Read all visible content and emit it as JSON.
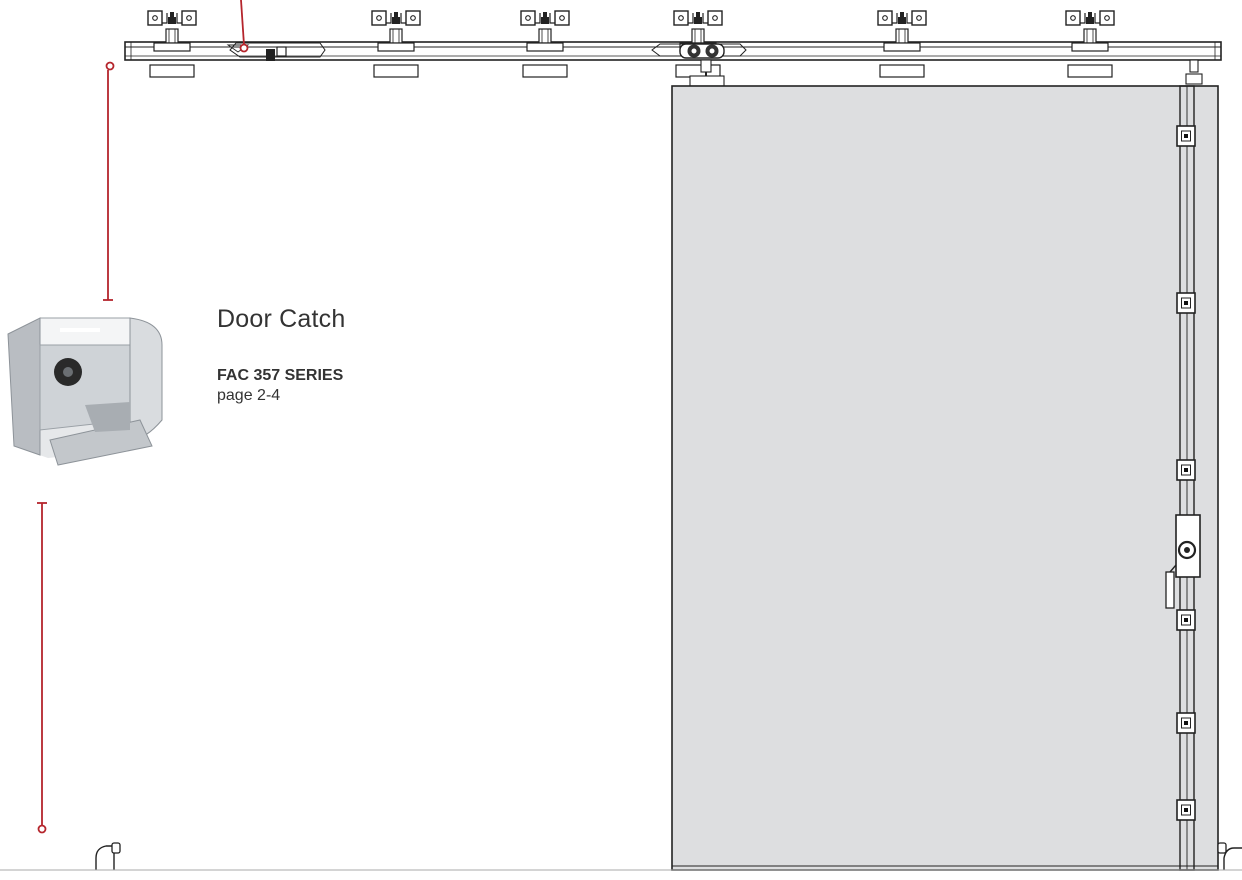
{
  "callout": {
    "title": "Door Catch",
    "series": "FAC 357 SERIES",
    "page": "page 2-4"
  },
  "colors": {
    "accent_red": "#b5252c",
    "door_fill": "#dddee0",
    "line_dark": "#333333",
    "catch_metal": "#c9ccd0"
  },
  "icons": [
    "door-catch-icon"
  ]
}
